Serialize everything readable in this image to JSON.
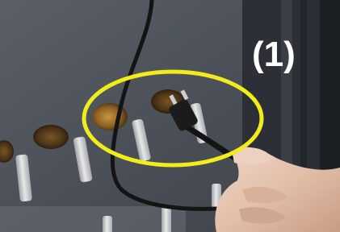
{
  "photo": {
    "step_label": "(1)",
    "highlight_color": "#f2ec1a",
    "panel_color": "#4b5058",
    "cable_color": "#111111"
  }
}
